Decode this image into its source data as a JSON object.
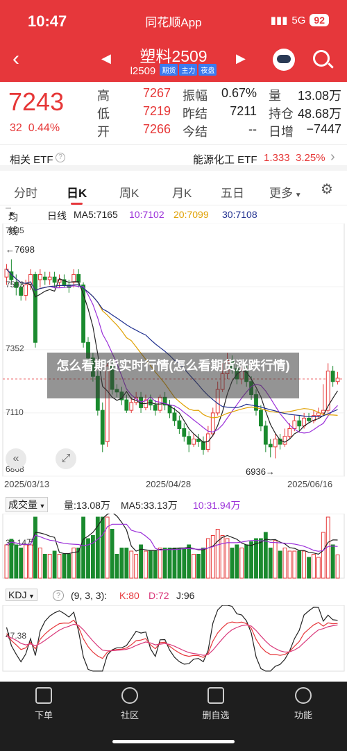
{
  "status": {
    "time": "10:47",
    "app": "同花顺App",
    "network": "5G",
    "battery": "92"
  },
  "nav": {
    "title": "塑料2509",
    "code": "l2509",
    "tags": [
      "期货",
      "主力",
      "夜盘"
    ]
  },
  "quote": {
    "price": "7243",
    "change": "32",
    "change_pct": "0.44%",
    "high_label": "高",
    "high": "7267",
    "low_label": "低",
    "low": "7219",
    "open_label": "开",
    "open": "7266",
    "amp_label": "振幅",
    "amp": "0.67%",
    "prev_label": "昨结",
    "prev": "7211",
    "settle_label": "今结",
    "settle": "--",
    "vol_label": "量",
    "vol": "13.08万",
    "oi_label": "持仓",
    "oi": "48.68万",
    "oi_chg_label": "日增",
    "oi_chg": "−7447"
  },
  "etf": {
    "label": "相关 ETF",
    "name": "能源化工 ETF",
    "price": "1.333",
    "pct": "3.25%"
  },
  "tabs": [
    "分时",
    "日K",
    "周K",
    "月K",
    "五日",
    "更多"
  ],
  "ma_legend": {
    "type": "均线",
    "period": "日线",
    "ma5": "MA5:7165",
    "ma10": "10:7102",
    "ma20": "20:7099",
    "ma30": "30:7108"
  },
  "price_axis": {
    "top": "7835",
    "mid1": "7593",
    "mid2": "7352",
    "mid3": "7110",
    "bottom": "6868",
    "high_mark": "7698",
    "low_mark": "6936"
  },
  "dates": [
    "2025/03/13",
    "2025/04/28",
    "2025/06/16"
  ],
  "volume": {
    "label": "成交量",
    "vol": "量:13.08万",
    "ma5": "MA5:33.13万",
    "ma10": "10:31.94万",
    "axis": "33.14万"
  },
  "kdj": {
    "label": "KDJ",
    "params": "(9, 3, 3):",
    "k": "K:80",
    "d": "D:72",
    "j": "J:96",
    "axis": "47.38"
  },
  "overlay_text": "怎么看期货实时行情(怎么看期货涨跌行情)",
  "bottom_nav": [
    "下单",
    "社区",
    "删自选",
    "功能"
  ],
  "colors": {
    "brand": "#e6373b",
    "up": "#e63737",
    "down": "#1a8a2e",
    "ma5": "#222222",
    "ma10": "#9b30d9",
    "ma20": "#e0a000",
    "ma30": "#1f2f8f"
  },
  "chart_data": {
    "type": "candlestick",
    "x_labels": [
      "2025/03/13",
      "2025/04/28",
      "2025/06/16"
    ],
    "ylim": [
      6868,
      7835
    ],
    "y_ticks": [
      7835,
      7593,
      7352,
      7110,
      6868
    ],
    "candles": [
      [
        7630,
        7660,
        7600,
        7680
      ],
      [
        7650,
        7620,
        7600,
        7698
      ],
      [
        7610,
        7590,
        7560,
        7640
      ],
      [
        7590,
        7560,
        7540,
        7610
      ],
      [
        7560,
        7600,
        7540,
        7620
      ],
      [
        7600,
        7640,
        7580,
        7660
      ],
      [
        7640,
        7380,
        7360,
        7650
      ],
      [
        7620,
        7640,
        7590,
        7660
      ],
      [
        7630,
        7620,
        7600,
        7650
      ],
      [
        7620,
        7630,
        7600,
        7650
      ],
      [
        7630,
        7610,
        7590,
        7650
      ],
      [
        7610,
        7620,
        7590,
        7640
      ],
      [
        7620,
        7600,
        7590,
        7640
      ],
      [
        7600,
        7590,
        7570,
        7620
      ],
      [
        7610,
        7640,
        7590,
        7660
      ],
      [
        7640,
        7610,
        7590,
        7660
      ],
      [
        7600,
        7380,
        7360,
        7610
      ],
      [
        7380,
        7320,
        7300,
        7400
      ],
      [
        7320,
        7250,
        7230,
        7340
      ],
      [
        7250,
        7120,
        7100,
        7270
      ],
      [
        7120,
        6990,
        6960,
        7150
      ],
      [
        7000,
        7290,
        6980,
        7300
      ],
      [
        7290,
        7200,
        7180,
        7310
      ],
      [
        7200,
        7190,
        7170,
        7220
      ],
      [
        7190,
        7160,
        7140,
        7210
      ],
      [
        7160,
        7120,
        7110,
        7180
      ],
      [
        7120,
        7150,
        7110,
        7170
      ],
      [
        7150,
        7170,
        7140,
        7190
      ],
      [
        7170,
        7130,
        7110,
        7190
      ],
      [
        7130,
        7160,
        7120,
        7180
      ],
      [
        7160,
        7140,
        7120,
        7180
      ],
      [
        7140,
        7120,
        7100,
        7160
      ],
      [
        7120,
        7170,
        7110,
        7180
      ],
      [
        7170,
        7140,
        7120,
        7190
      ],
      [
        7140,
        7110,
        7090,
        7160
      ],
      [
        7110,
        7080,
        7060,
        7130
      ],
      [
        7080,
        7050,
        7030,
        7100
      ],
      [
        7050,
        7020,
        7000,
        7070
      ],
      [
        7020,
        6990,
        6960,
        7040
      ],
      [
        6990,
        7010,
        6980,
        7030
      ],
      [
        7010,
        7000,
        6980,
        7030
      ],
      [
        7000,
        6970,
        6950,
        7020
      ],
      [
        6970,
        7030,
        6960,
        7060
      ],
      [
        7030,
        7110,
        7020,
        7130
      ],
      [
        7110,
        7200,
        7100,
        7230
      ],
      [
        7200,
        7260,
        7190,
        7300
      ],
      [
        7260,
        7310,
        7240,
        7340
      ],
      [
        7310,
        7280,
        7260,
        7330
      ],
      [
        7280,
        7240,
        7220,
        7300
      ],
      [
        7240,
        7270,
        7220,
        7290
      ],
      [
        7270,
        7230,
        7210,
        7290
      ],
      [
        7230,
        7180,
        7160,
        7250
      ],
      [
        7180,
        7120,
        7100,
        7200
      ],
      [
        7120,
        7060,
        7040,
        7140
      ],
      [
        7060,
        6990,
        6960,
        7080
      ],
      [
        6990,
        6980,
        6940,
        7010
      ],
      [
        6980,
        7010,
        6936,
        7030
      ],
      [
        7010,
        6990,
        6970,
        7030
      ],
      [
        6990,
        7020,
        6980,
        7050
      ],
      [
        7020,
        7050,
        7010,
        7070
      ],
      [
        7050,
        7080,
        7040,
        7100
      ],
      [
        7080,
        7060,
        7040,
        7100
      ],
      [
        7060,
        7090,
        7050,
        7110
      ],
      [
        7090,
        7080,
        7070,
        7110
      ],
      [
        7080,
        7100,
        7070,
        7120
      ],
      [
        7100,
        7110,
        7090,
        7130
      ],
      [
        7110,
        7120,
        7100,
        7220
      ],
      [
        7120,
        7270,
        7110,
        7300
      ],
      [
        7270,
        7230,
        7210,
        7290
      ],
      [
        7230,
        7243,
        7219,
        7267
      ]
    ]
  }
}
